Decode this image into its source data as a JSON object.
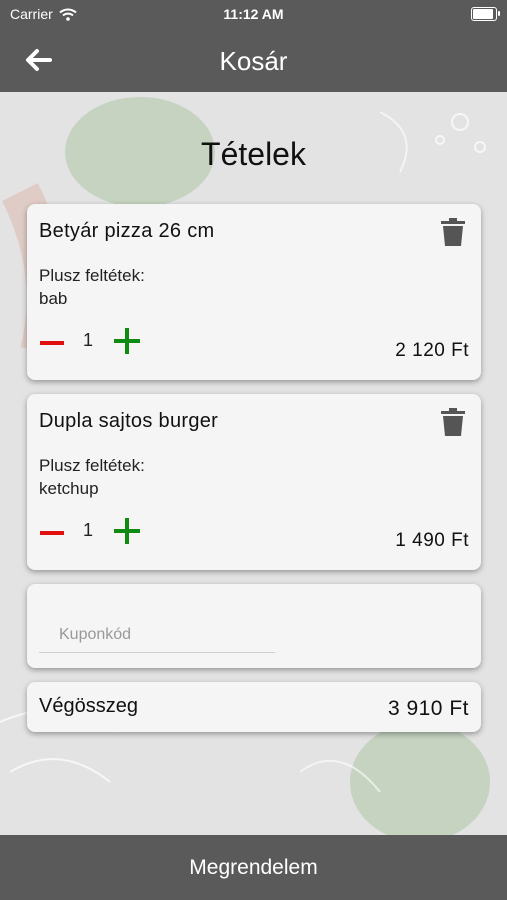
{
  "status_bar": {
    "carrier": "Carrier",
    "time": "11:12 AM",
    "wifi_icon": "wifi-icon",
    "battery_icon": "battery-icon"
  },
  "nav": {
    "title": "Kosár",
    "back_icon": "arrow-left-icon"
  },
  "main": {
    "heading": "Tételek",
    "items": [
      {
        "name": "Betyár pizza 26 cm",
        "extras_label": "Plusz feltétek:",
        "extras": "bab",
        "quantity": "1",
        "price": "2 120 Ft"
      },
      {
        "name": "Dupla sajtos burger",
        "extras_label": "Plusz feltétek:",
        "extras": "ketchup",
        "quantity": "1",
        "price": "1 490 Ft"
      }
    ],
    "coupon": {
      "placeholder": "Kuponkód",
      "value": ""
    },
    "total": {
      "label": "Végösszeg",
      "value": "3 910 Ft"
    }
  },
  "footer": {
    "order_button": "Megrendelem"
  },
  "colors": {
    "bar": "#5a5a5a",
    "minus": "#e01010",
    "plus": "#118a11",
    "card": "#f5f5f5"
  }
}
